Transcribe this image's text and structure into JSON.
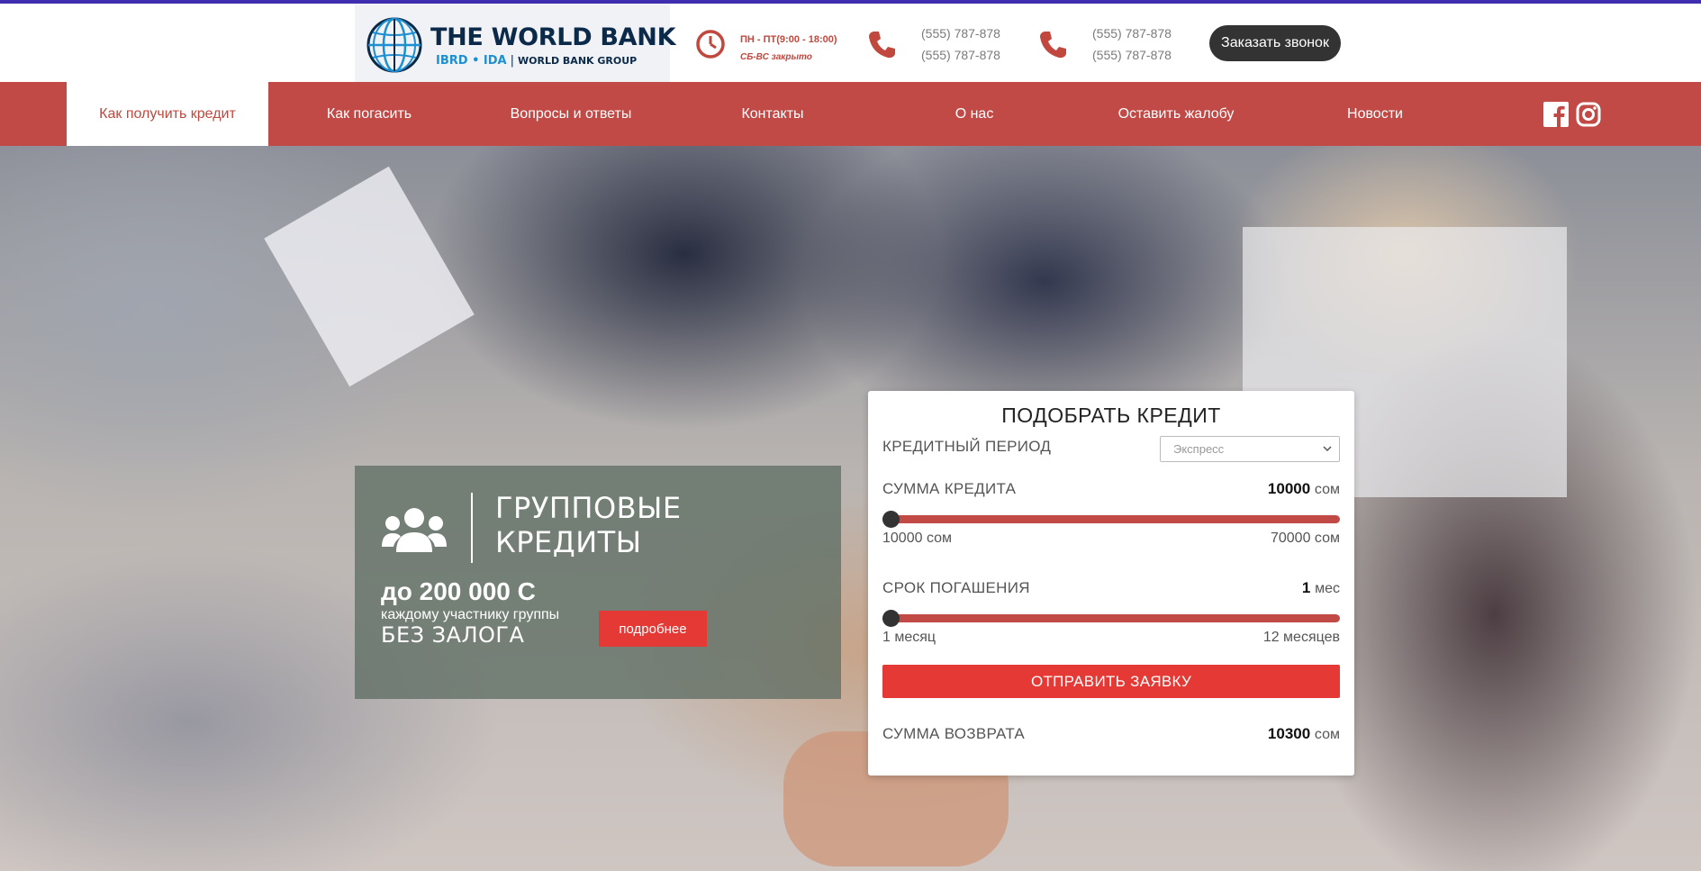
{
  "brand": {
    "title": "THE WORLD BANK",
    "sub_ibrd": "IBRD • IDA",
    "sub_group": "WORLD BANK GROUP"
  },
  "header": {
    "hours_weekdays": "ПН - ПТ(9:00 - 18:00)",
    "hours_weekend": "СБ-ВС закрыто",
    "phones_1": [
      "(555) 787-878",
      "(555) 787-878"
    ],
    "phones_2": [
      "(555) 787-878",
      "(555) 787-878"
    ],
    "callback_label": "Заказать звонок"
  },
  "nav": {
    "items": [
      {
        "label": "Как получить кредит",
        "active": true
      },
      {
        "label": "Как погасить"
      },
      {
        "label": "Вопросы и ответы"
      },
      {
        "label": "Контакты"
      },
      {
        "label": "О нас"
      },
      {
        "label": "Оставить жалобу"
      },
      {
        "label": "Новости"
      }
    ],
    "social": [
      "facebook-icon",
      "instagram-icon"
    ]
  },
  "promo": {
    "title_line1": "ГРУППОВЫЕ",
    "title_line2": "КРЕДИТЫ",
    "amount": "до 200 000 С",
    "each_member": "каждому участнику группы",
    "no_collateral": "БЕЗ ЗАЛОГА",
    "more_label": "подробнее"
  },
  "calculator": {
    "title": "ПОДОБРАТЬ КРЕДИТ",
    "period_label": "КРЕДИТНЫЙ ПЕРИОД",
    "period_value": "Экспресс",
    "amount_label": "СУММА КРЕДИТА",
    "amount_value": "10000",
    "amount_unit": "сом",
    "amount_min": "10000 сом",
    "amount_max": "70000 сом",
    "amount_fraction": 0,
    "term_label": "СРОК ПОГАШЕНИЯ",
    "term_value": "1",
    "term_unit": "мес",
    "term_min": "1 месяц",
    "term_max": "12 месяцев",
    "term_fraction": 0,
    "submit_label": "ОТПРАВИТЬ ЗАЯВКУ",
    "return_label": "СУММА ВОЗВРАТА",
    "return_value": "10300",
    "return_unit": "сом"
  },
  "colors": {
    "nav_bg": "#c14a47",
    "accent_red": "#e53935",
    "top_line": "#3f2fb0",
    "dark_button": "#333333"
  }
}
